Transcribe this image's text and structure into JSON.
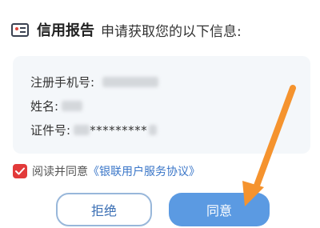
{
  "header": {
    "brand": "信用报告",
    "request_text": "申请获取您的以下信息:"
  },
  "info": {
    "phone_label": "注册手机号:",
    "name_label": "姓名:",
    "id_label": "证件号:",
    "id_masked": "*********"
  },
  "consent": {
    "checked": true,
    "text": "阅读并同意",
    "link": "《银联用户服务协议》"
  },
  "buttons": {
    "reject": "拒绝",
    "agree": "同意"
  },
  "colors": {
    "checkbox": "#e23a3a",
    "primary": "#5b9ae2",
    "link": "#3a76c8",
    "arrow": "#f5932e"
  }
}
